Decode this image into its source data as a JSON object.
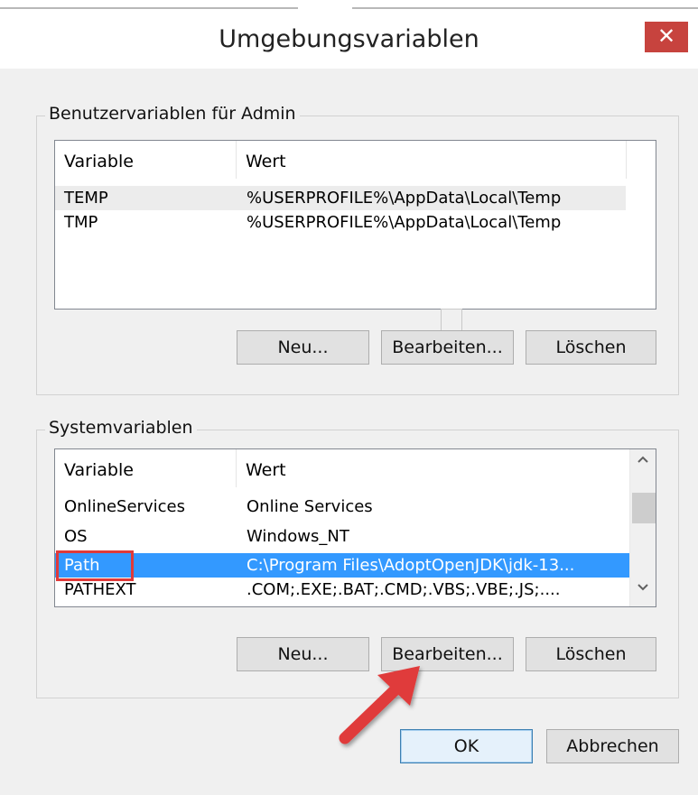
{
  "window": {
    "title": "Umgebungsvariablen",
    "close_label": "✕"
  },
  "user_group": {
    "label": "Benutzervariablen für Admin",
    "columns": [
      "Variable",
      "Wert"
    ],
    "rows": [
      {
        "name": "TEMP",
        "value": "%USERPROFILE%\\AppData\\Local\\Temp"
      },
      {
        "name": "TMP",
        "value": "%USERPROFILE%\\AppData\\Local\\Temp"
      }
    ],
    "buttons": {
      "new": "Neu...",
      "edit": "Bearbeiten...",
      "delete": "Löschen"
    }
  },
  "system_group": {
    "label": "Systemvariablen",
    "columns": [
      "Variable",
      "Wert"
    ],
    "rows": [
      {
        "name": "OnlineServices",
        "value": "Online Services"
      },
      {
        "name": "OS",
        "value": "Windows_NT"
      },
      {
        "name": "Path",
        "value": "C:\\Program Files\\AdoptOpenJDK\\jdk-13..."
      },
      {
        "name": "PATHEXT",
        "value": ".COM;.EXE;.BAT;.CMD;.VBS;.VBE;.JS;...."
      }
    ],
    "selected_row": "Path",
    "buttons": {
      "new": "Neu...",
      "edit": "Bearbeiten...",
      "delete": "Löschen"
    },
    "scroll_up_icon": "chevron-up-icon",
    "scroll_down_icon": "chevron-down-icon"
  },
  "footer": {
    "ok": "OK",
    "cancel": "Abbrechen"
  },
  "annotations": {
    "highlight_color": "#e03a3a",
    "arrow_color": "#e03a3a"
  }
}
